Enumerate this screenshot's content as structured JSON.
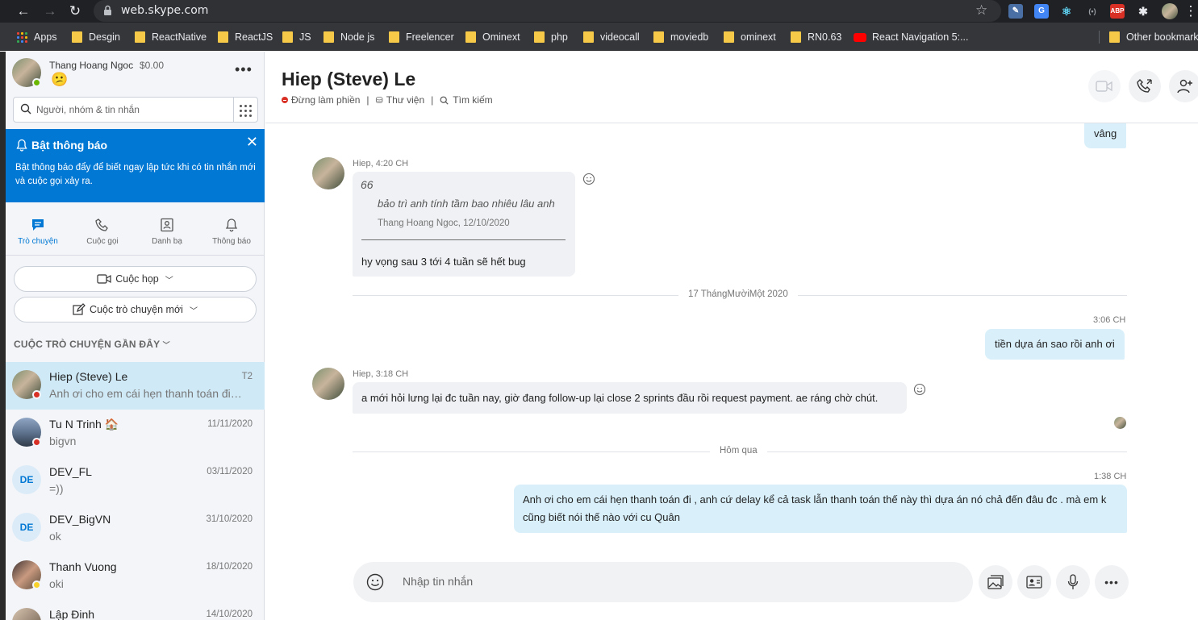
{
  "browser": {
    "url": "web.skype.com",
    "bookmarks": [
      "Apps",
      "Desgin",
      "ReactNative",
      "ReactJS",
      "JS",
      "Node js",
      "Freelencer",
      "Ominext",
      "php",
      "videocall",
      "moviedb",
      "ominext",
      "RN0.63",
      "React Navigation 5:...",
      "Other bookmarks"
    ],
    "ext_abp": "ABP"
  },
  "profile": {
    "name": "Thang Hoang Ngoc",
    "balance": "$0.00",
    "mood_icon": "😕"
  },
  "search": {
    "placeholder": "Người, nhóm & tin nhắn"
  },
  "notification": {
    "title": "Bật thông báo",
    "body": "Bật thông báo đẩy để biết ngay lập tức khi có tin nhắn mới và cuộc gọi xảy ra."
  },
  "tabs": [
    {
      "label": "Trò chuyện",
      "active": true
    },
    {
      "label": "Cuộc gọi"
    },
    {
      "label": "Danh bạ"
    },
    {
      "label": "Thông báo"
    }
  ],
  "actions": {
    "meeting": "Cuộc họp",
    "new_chat": "Cuộc trò chuyện mới"
  },
  "recent_header": "CUỘC TRÒ CHUYỆN GẦN ĐÂY",
  "conversations": [
    {
      "name": "Hiep (Steve) Le",
      "preview": "Anh ơi cho em cái hẹn thanh toán đi , anh cứ delay",
      "time": "T2",
      "active": true
    },
    {
      "name": "Tu N Trinh 🏠",
      "preview": "bigvn",
      "time": "11/11/2020"
    },
    {
      "name": "DEV_FL",
      "preview": "=))",
      "time": "03/11/2020",
      "initials": "DE"
    },
    {
      "name": "DEV_BigVN",
      "preview": "ok",
      "time": "31/10/2020",
      "initials": "DE"
    },
    {
      "name": "Thanh Vuong",
      "preview": "oki",
      "time": "18/10/2020"
    },
    {
      "name": "Lập Đinh",
      "preview": "",
      "time": "14/10/2020"
    }
  ],
  "chat": {
    "title": "Hiep (Steve) Le",
    "status": "Đừng làm phiền",
    "gallery": "Thư viện",
    "find": "Tìm kiếm",
    "colors": {
      "accent": "#0078d4",
      "dnd": "#d93025"
    },
    "messages": {
      "m0_text": "vâng",
      "m1_meta": "Hiep, 4:20 CH",
      "m1_quote_mark": "66",
      "m1_quote": "bảo trì anh tính tầm bao nhiêu lâu anh",
      "m1_quote_meta": "Thang Hoang Ngoc, 12/10/2020",
      "m1_text": "hy vọng sau 3 tới 4 tuần sẽ hết bug",
      "div1": "17 ThángMườiMột 2020",
      "m2_time": "3:06 CH",
      "m2_text": "tiền dựa án sao rồi anh ơi",
      "m3_meta": "Hiep, 3:18 CH",
      "m3_text": "a mới hỏi lưng lại đc tuần nay, giờ đang follow-up lại close 2 sprints đầu rồi request payment. ae ráng chờ chút.",
      "div2": "Hôm qua",
      "m4_time": "1:38 CH",
      "m4_text": "Anh ơi cho em cái hẹn thanh toán đi , anh cứ delay kể cả task lẫn thanh toán thế này thì dựa án nó chả đến đâu đc . mà em k cũng biết nói thế nào với cu Quân"
    },
    "composer_placeholder": "Nhập tin nhắn"
  }
}
